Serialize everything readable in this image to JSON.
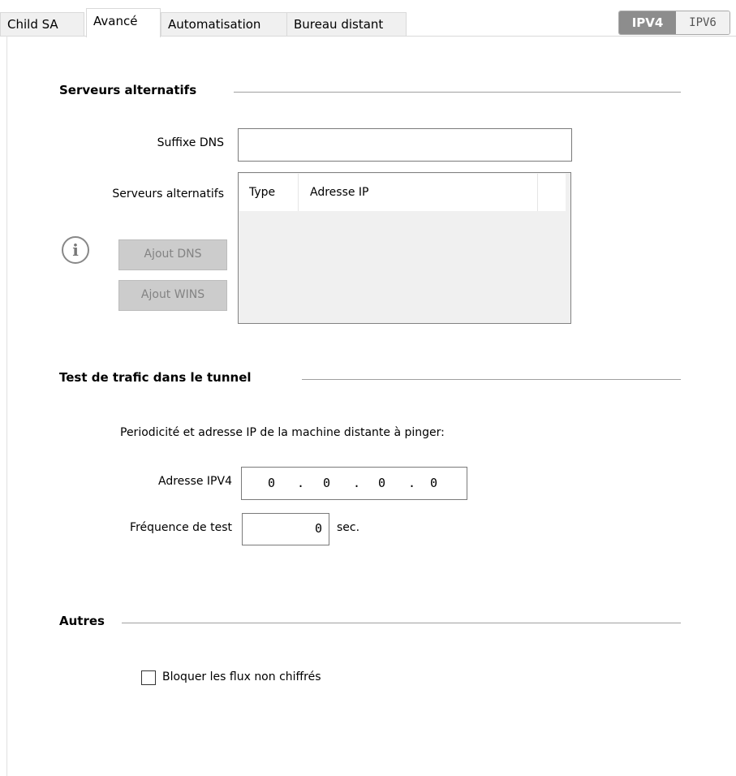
{
  "tabs": [
    {
      "label": "Child SA",
      "active": false
    },
    {
      "label": "Avancé",
      "active": true
    },
    {
      "label": "Automatisation",
      "active": false
    },
    {
      "label": "Bureau distant",
      "active": false
    }
  ],
  "ip_toggle": {
    "ipv4": "IPV4",
    "ipv6": "IPV6",
    "selected": "IPV4"
  },
  "alt_servers": {
    "title": "Serveurs alternatifs",
    "dns_suffix_label": "Suffixe DNS",
    "dns_suffix_value": "",
    "servers_label": "Serveurs alternatifs",
    "columns": [
      "Type",
      "Adresse IP"
    ],
    "rows": [],
    "add_dns_label": "Ajout DNS",
    "add_wins_label": "Ajout WINS",
    "info_icon": "i"
  },
  "traffic_test": {
    "title": "Test de trafic dans le tunnel",
    "description": "Periodicité et adresse IP de la machine distante à pinger:",
    "ip_label": "Adresse IPV4",
    "ip_octets": [
      "0",
      "0",
      "0",
      "0"
    ],
    "ip_dot": ".",
    "frequency_label": "Fréquence de test",
    "frequency_value": "0",
    "frequency_unit": "sec."
  },
  "others": {
    "title": "Autres",
    "block_unencrypted_label": "Bloquer les flux non chiffrés",
    "block_unencrypted_checked": false
  },
  "colors": {
    "ipv4_active_bg": "#8d8d8d",
    "disabled_button_bg": "#cccccc",
    "list_bg": "#f0f0f0"
  }
}
